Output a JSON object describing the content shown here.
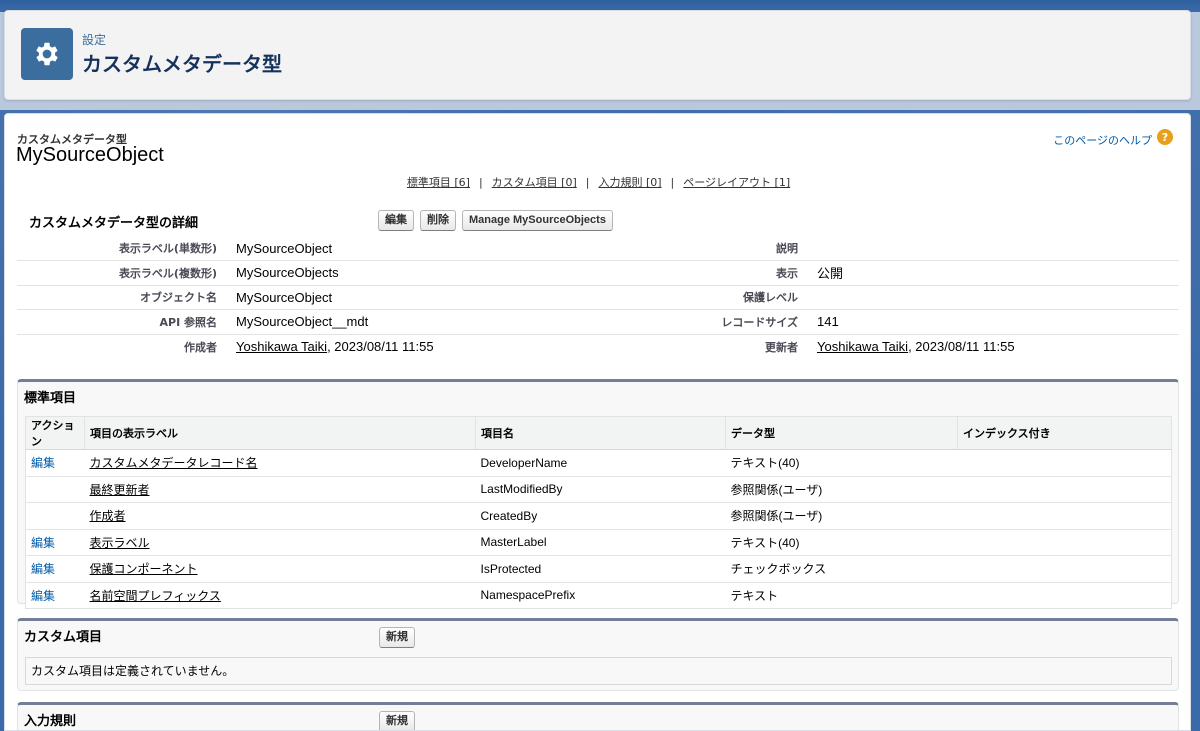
{
  "header": {
    "breadcrumb": "設定",
    "title": "カスタムメタデータ型",
    "icon": "gear-icon"
  },
  "object": {
    "type_label": "カスタムメタデータ型",
    "name": "MySourceObject",
    "help_link": "このページのヘルプ",
    "help_icon": "?"
  },
  "related_links": [
    "標準項目 [6]",
    "カスタム項目 [0]",
    "入力規則 [0]",
    "ページレイアウト [1]"
  ],
  "related_sep": "|",
  "detail": {
    "title": "カスタムメタデータ型の詳細",
    "buttons": {
      "edit": "編集",
      "delete": "削除",
      "manage": "Manage MySourceObjects"
    },
    "rows": [
      {
        "l1": "表示ラベル(単数形)",
        "v1": "MySourceObject",
        "l2": "説明",
        "v2": ""
      },
      {
        "l1": "表示ラベル(複数形)",
        "v1": "MySourceObjects",
        "l2": "表示",
        "v2": "公開"
      },
      {
        "l1": "オブジェクト名",
        "v1": "MySourceObject",
        "l2": "保護レベル",
        "v2": ""
      },
      {
        "l1": "API 参照名",
        "v1": "MySourceObject__mdt",
        "l2": "レコードサイズ",
        "v2": "141"
      },
      {
        "l1": "作成者",
        "v1_link": "Yoshikawa Taiki",
        "v1": ", 2023/08/11 11:55",
        "l2": "更新者",
        "v2_link": "Yoshikawa Taiki",
        "v2": ", 2023/08/11 11:55"
      }
    ]
  },
  "standard_fields": {
    "title": "標準項目",
    "headers": [
      "アクション",
      "項目の表示ラベル",
      "項目名",
      "データ型",
      "インデックス付き"
    ],
    "rows": [
      {
        "action": "編集",
        "label": "カスタムメタデータレコード名",
        "api": "DeveloperName",
        "type": "テキスト(40)",
        "indexed": ""
      },
      {
        "action": "",
        "label": "最終更新者",
        "api": "LastModifiedBy",
        "type": "参照関係(ユーザ)",
        "indexed": ""
      },
      {
        "action": "",
        "label": "作成者",
        "api": "CreatedBy",
        "type": "参照関係(ユーザ)",
        "indexed": ""
      },
      {
        "action": "編集",
        "label": "表示ラベル",
        "api": "MasterLabel",
        "type": "テキスト(40)",
        "indexed": ""
      },
      {
        "action": "編集",
        "label": "保護コンポーネント",
        "api": "IsProtected",
        "type": "チェックボックス",
        "indexed": ""
      },
      {
        "action": "編集",
        "label": "名前空間プレフィックス",
        "api": "NamespacePrefix",
        "type": "テキスト",
        "indexed": ""
      }
    ]
  },
  "custom_fields": {
    "title": "カスタム項目",
    "new_button": "新規",
    "empty_message": "カスタム項目は定義されていません。"
  },
  "validation_rules": {
    "title": "入力規則",
    "new_button": "新規"
  }
}
